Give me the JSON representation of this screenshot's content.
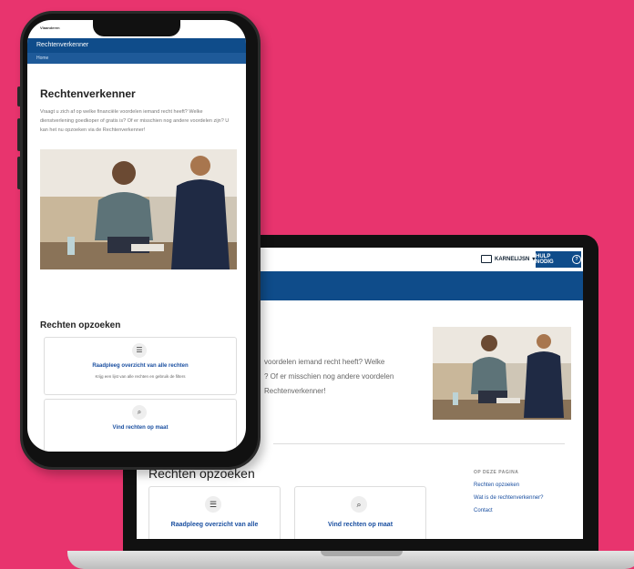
{
  "colors": {
    "background": "#e8346e",
    "brand_blue": "#0f4c8a",
    "link_blue": "#1a4fa0"
  },
  "laptop": {
    "language_label": "KARNELIJSN",
    "help_label": "HULP NODIG",
    "title": "r\"",
    "intro_lines": [
      "voordelen iemand recht heeft? Welke",
      "? Of er misschien nog andere voordelen",
      "Rechtenverkenner!"
    ],
    "section_title": "Rechten opzoeken",
    "cards": [
      {
        "icon": "list-icon",
        "label": "Raadpleeg overzicht van alle"
      },
      {
        "icon": "search-icon",
        "label": "Vind rechten op maat"
      }
    ],
    "toc_heading": "OP DEZE PAGINA",
    "toc_items": [
      "Rechten opzoeken",
      "Wat is de rechtenverkenner?",
      "Contact"
    ]
  },
  "phone": {
    "status_text": "Vlaanderen",
    "app_name": "Rechtenverkenner",
    "breadcrumb": "Home",
    "title": "Rechtenverkenner",
    "intro": "Vraagt u zich af op welke financiële voordelen iemand recht heeft? Welke dienstverlening goedkoper of gratis is? Of er misschien nog andere voordelen zijn? U kan het nu opzoeken via de Rechtenverkenner!",
    "section_title": "Rechten opzoeken",
    "cards": [
      {
        "icon": "list-icon",
        "label": "Raadpleeg overzicht van alle rechten",
        "sub": "Krijg een lijst van alle rechten en gebruik de filters"
      },
      {
        "icon": "search-icon",
        "label": "Vind rechten op maat",
        "sub": ""
      }
    ]
  }
}
